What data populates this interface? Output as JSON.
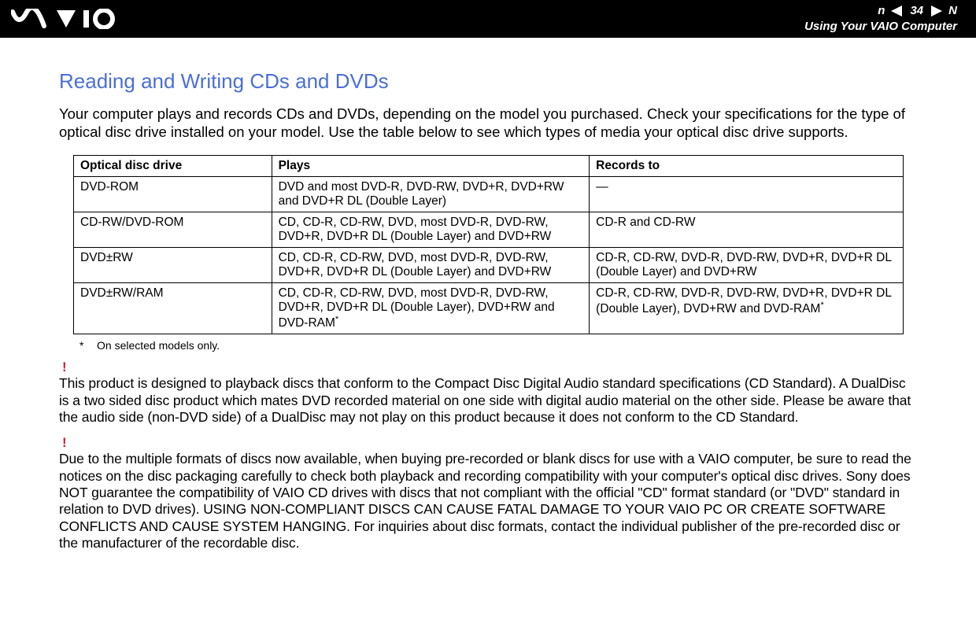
{
  "header": {
    "page_number": "34",
    "breadcrumb": "Using Your VAIO Computer",
    "n_label": "n",
    "N_label": "N"
  },
  "title": "Reading and Writing CDs and DVDs",
  "intro": "Your computer plays and records CDs and DVDs, depending on the model you purchased. Check your specifications for the type of optical disc drive installed on your model. Use the table below to see which types of media your optical disc drive supports.",
  "table": {
    "headers": {
      "drive": "Optical disc drive",
      "plays": "Plays",
      "records": "Records to"
    },
    "rows": [
      {
        "drive": "DVD-ROM",
        "plays": "DVD and most DVD-R, DVD-RW, DVD+R, DVD+RW and DVD+R DL (Double Layer)",
        "records": "—"
      },
      {
        "drive": "CD-RW/DVD-ROM",
        "plays": "CD, CD-R, CD-RW, DVD, most DVD-R, DVD-RW, DVD+R, DVD+R DL (Double Layer) and DVD+RW",
        "records": "CD-R and CD-RW"
      },
      {
        "drive": "DVD±RW",
        "plays": "CD, CD-R, CD-RW, DVD, most DVD-R, DVD-RW, DVD+R, DVD+R DL (Double Layer) and DVD+RW",
        "records": "CD-R, CD-RW, DVD-R, DVD-RW, DVD+R, DVD+R DL (Double Layer) and DVD+RW"
      },
      {
        "drive": "DVD±RW/RAM",
        "plays_pre": "CD, CD-R, CD-RW, DVD, most DVD-R, DVD-RW, DVD+R, DVD+R DL (Double Layer), DVD+RW and DVD-RAM",
        "records_pre": "CD-R, CD-RW, DVD-R, DVD-RW, DVD+R, DVD+R DL (Double Layer), DVD+RW and DVD-RAM",
        "sup": "*"
      }
    ]
  },
  "footnote": {
    "star": "*",
    "text": "On selected models only."
  },
  "warnings": {
    "mark": "!",
    "w1": "This product is designed to playback discs that conform to the Compact Disc Digital Audio standard specifications (CD Standard). A DualDisc is a two sided disc product which mates DVD recorded material on one side with digital audio material on the other side. Please be aware that the audio side (non-DVD side) of a DualDisc may not play on this product because it does not conform to the CD Standard.",
    "w2": "Due to the multiple formats of discs now available, when buying pre-recorded or blank discs for use with a VAIO computer, be sure to read the notices on the disc packaging carefully to check both playback and recording compatibility with your computer's optical disc drives. Sony does NOT guarantee the compatibility of VAIO CD drives with discs that not compliant with the official \"CD\" format standard (or \"DVD\" standard in relation to DVD drives). USING NON-COMPLIANT DISCS CAN CAUSE FATAL DAMAGE TO YOUR VAIO PC OR CREATE SOFTWARE CONFLICTS AND CAUSE SYSTEM HANGING. For inquiries about disc formats, contact the individual publisher of the pre-recorded disc or the manufacturer of the recordable disc."
  }
}
